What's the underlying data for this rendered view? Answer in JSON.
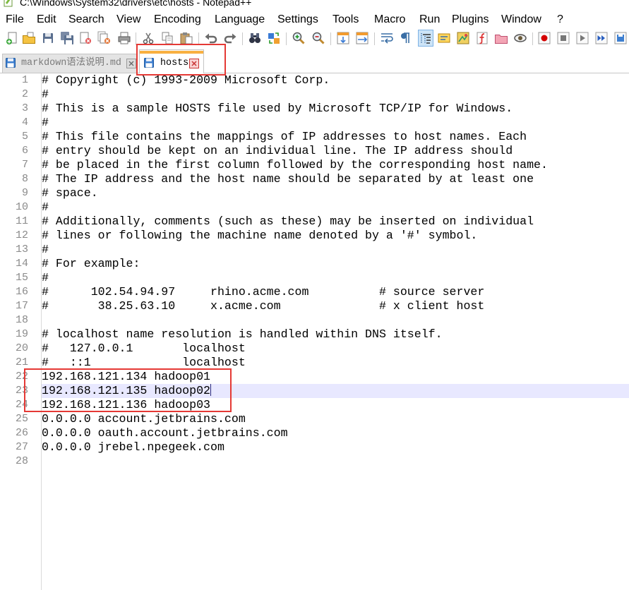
{
  "window": {
    "title": "C:\\Windows\\System32\\drivers\\etc\\hosts - Notepad++"
  },
  "menu": [
    {
      "label": "File"
    },
    {
      "label": "Edit"
    },
    {
      "label": "Search"
    },
    {
      "label": "View"
    },
    {
      "label": "Encoding"
    },
    {
      "label": "Language"
    },
    {
      "label": "Settings"
    },
    {
      "label": "Tools"
    },
    {
      "label": "Macro"
    },
    {
      "label": "Run"
    },
    {
      "label": "Plugins"
    },
    {
      "label": "Window"
    },
    {
      "label": "?"
    }
  ],
  "toolbar": {
    "icons": [
      "new-file-icon",
      "open-file-icon",
      "save-icon",
      "save-all-icon",
      "close-file-icon",
      "close-all-icon",
      "print-icon",
      "cut-icon",
      "copy-icon",
      "paste-icon",
      "undo-icon",
      "redo-icon",
      "find-icon",
      "replace-icon",
      "zoom-in-icon",
      "zoom-out-icon",
      "sync-vertical-scroll-icon",
      "sync-horizontal-scroll-icon",
      "word-wrap-icon",
      "show-all-characters-icon",
      "indent-guide-icon",
      "user-defined-language-icon",
      "document-map-icon",
      "function-list-icon",
      "folder-as-workspace-icon",
      "document-monitor-icon",
      "macro-record-icon",
      "macro-stop-icon",
      "macro-playback-icon",
      "macro-run-multiple-icon",
      "macro-save-icon"
    ],
    "pressed": "indent-guide-icon"
  },
  "tabs": [
    {
      "label": "markdown语法说明.md",
      "active": false
    },
    {
      "label": "hosts",
      "active": true
    }
  ],
  "editor": {
    "current_line": 23,
    "lines": [
      {
        "n": 1,
        "text": "# Copyright (c) 1993-2009 Microsoft Corp."
      },
      {
        "n": 2,
        "text": "#"
      },
      {
        "n": 3,
        "text": "# This is a sample HOSTS file used by Microsoft TCP/IP for Windows."
      },
      {
        "n": 4,
        "text": "#"
      },
      {
        "n": 5,
        "text": "# This file contains the mappings of IP addresses to host names. Each"
      },
      {
        "n": 6,
        "text": "# entry should be kept on an individual line. The IP address should"
      },
      {
        "n": 7,
        "text": "# be placed in the first column followed by the corresponding host name."
      },
      {
        "n": 8,
        "text": "# The IP address and the host name should be separated by at least one"
      },
      {
        "n": 9,
        "text": "# space."
      },
      {
        "n": 10,
        "text": "#"
      },
      {
        "n": 11,
        "text": "# Additionally, comments (such as these) may be inserted on individual"
      },
      {
        "n": 12,
        "text": "# lines or following the machine name denoted by a '#' symbol."
      },
      {
        "n": 13,
        "text": "#"
      },
      {
        "n": 14,
        "text": "# For example:"
      },
      {
        "n": 15,
        "text": "#"
      },
      {
        "n": 16,
        "text": "#      102.54.94.97     rhino.acme.com          # source server"
      },
      {
        "n": 17,
        "text": "#       38.25.63.10     x.acme.com              # x client host"
      },
      {
        "n": 18,
        "text": ""
      },
      {
        "n": 19,
        "text": "# localhost name resolution is handled within DNS itself."
      },
      {
        "n": 20,
        "text": "#   127.0.0.1       localhost"
      },
      {
        "n": 21,
        "text": "#   ::1             localhost"
      },
      {
        "n": 22,
        "text": "192.168.121.134 hadoop01"
      },
      {
        "n": 23,
        "text": "192.168.121.135 hadoop02"
      },
      {
        "n": 24,
        "text": "192.168.121.136 hadoop03"
      },
      {
        "n": 25,
        "text": "0.0.0.0 account.jetbrains.com"
      },
      {
        "n": 26,
        "text": "0.0.0.0 oauth.account.jetbrains.com"
      },
      {
        "n": 27,
        "text": "0.0.0.0 jrebel.npegeek.com"
      },
      {
        "n": 28,
        "text": ""
      }
    ]
  },
  "colors": {
    "active_tab_accent": "#f8b041",
    "current_line": "#e8e8ff",
    "annotation": "#e53935",
    "line_number": "#8a8a8a",
    "tab_file_icon": "#3d7fd0"
  }
}
